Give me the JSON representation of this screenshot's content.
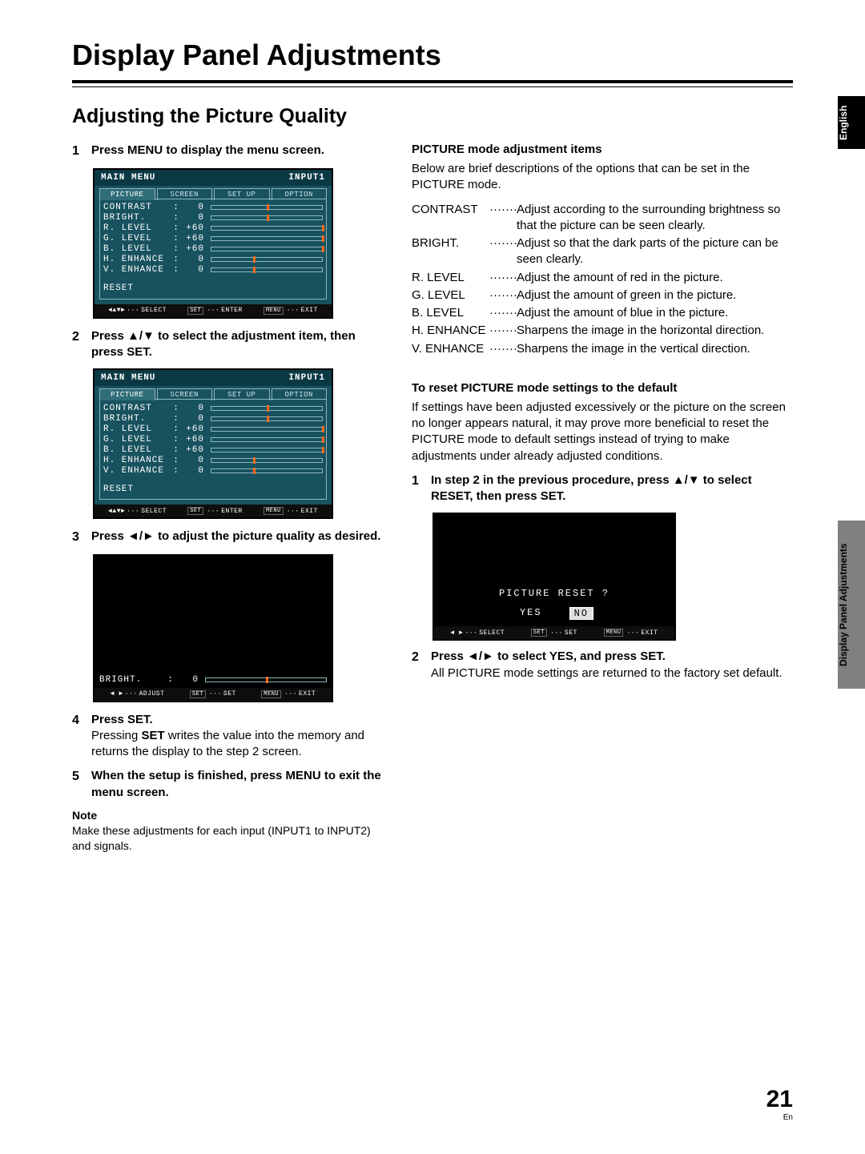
{
  "title": "Display Panel Adjustments",
  "section": "Adjusting the Picture Quality",
  "side_tabs": {
    "english": "English",
    "dpa": "Display Panel Adjustments"
  },
  "left": {
    "step1": "Press MENU to display the menu screen.",
    "step2": "Press ▲/▼ to select the adjustment item, then press SET.",
    "step3": "Press ◄/► to adjust the picture quality as desired.",
    "step4_head": "Press SET.",
    "step4_body_a": "Pressing ",
    "step4_body_bold": "SET",
    "step4_body_b": " writes the value into the memory and returns the display to the step 2 screen.",
    "step5": "When the setup is finished, press MENU to exit the menu screen.",
    "note_label": "Note",
    "note_body": "Make these adjustments for each input (INPUT1 to INPUT2) and signals."
  },
  "osd_common": {
    "main_menu": "MAIN  MENU",
    "input": "INPUT1",
    "tabs": [
      "PICTURE",
      "SCREEN",
      "SET UP",
      "OPTION"
    ],
    "reset": "RESET",
    "foot_select": "SELECT",
    "foot_enter": "ENTER",
    "foot_exit": "EXIT",
    "foot_adjust": "ADJUST",
    "foot_set": "SET",
    "btn_set": "SET",
    "btn_menu": "MENU"
  },
  "osd_items": [
    {
      "label": "CONTRAST",
      "value": "0",
      "pos": 50
    },
    {
      "label": "BRIGHT.",
      "value": "0",
      "pos": 50
    },
    {
      "label": "R. LEVEL",
      "value": "+60",
      "pos": 100
    },
    {
      "label": "G. LEVEL",
      "value": "+60",
      "pos": 100
    },
    {
      "label": "B. LEVEL",
      "value": "+60",
      "pos": 100
    },
    {
      "label": "H. ENHANCE",
      "value": "0",
      "pos": 38
    },
    {
      "label": "V. ENHANCE",
      "value": "0",
      "pos": 38
    }
  ],
  "osd_single": {
    "label": "BRIGHT.",
    "value": "0",
    "pos": 50
  },
  "right": {
    "head1": "PICTURE mode adjustment items",
    "intro": "Below are brief descriptions of the options that can be set in the PICTURE mode.",
    "defs": [
      {
        "term": "CONTRAST",
        "desc": "Adjust according to the surrounding brightness so that the picture can be seen clearly."
      },
      {
        "term": "BRIGHT.",
        "desc": "Adjust so that the dark parts of the picture can be seen clearly."
      },
      {
        "term": "R. LEVEL",
        "desc": "Adjust the amount of red in the picture."
      },
      {
        "term": "G. LEVEL",
        "desc": "Adjust the amount of green in the picture."
      },
      {
        "term": "B. LEVEL",
        "desc": "Adjust the amount of blue in the picture."
      },
      {
        "term": "H. ENHANCE",
        "desc": "Sharpens the image in the horizontal direction."
      },
      {
        "term": "V. ENHANCE",
        "desc": "Sharpens the image in the vertical direction."
      }
    ],
    "head2": "To reset PICTURE mode settings to the default",
    "reset_intro": "If settings have been adjusted excessively or the picture on the screen no longer appears natural, it may prove more beneficial to reset the PICTURE mode to default settings instead of trying to make adjustments under already adjusted conditions.",
    "reset_step1": "In step 2 in the previous procedure, press ▲/▼ to select RESET, then press SET.",
    "reset_prompt": "PICTURE   RESET  ?",
    "yes": "YES",
    "no": "NO",
    "reset_step2_head": "Press ◄/► to select YES, and press SET.",
    "reset_step2_body": "All PICTURE mode settings are returned to the factory set default."
  },
  "page_number": "21",
  "page_lang": "En"
}
